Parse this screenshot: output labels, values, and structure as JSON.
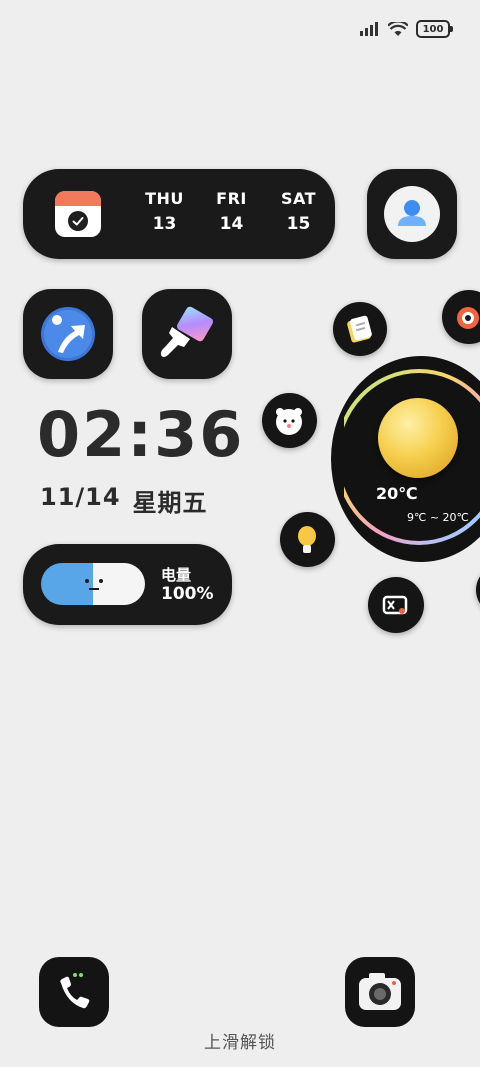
{
  "status_bar": {
    "battery": "100"
  },
  "calendar": {
    "days": [
      {
        "name": "THU",
        "num": "13"
      },
      {
        "name": "FRI",
        "num": "14"
      },
      {
        "name": "SAT",
        "num": "15"
      }
    ]
  },
  "clock": {
    "time": "02:36",
    "date": "11/14",
    "weekday": "星期五"
  },
  "battery_widget": {
    "label": "电量",
    "value": "100%"
  },
  "weather": {
    "temp": "20℃",
    "range": "9℃ ~ 20℃"
  },
  "lock": {
    "hint": "上滑解锁"
  },
  "colors": {
    "background": "#eeeeee",
    "widget_dark": "#1a1a1a",
    "calendar_red": "#f07a5b",
    "pill_blue": "#58a6e8",
    "sun_yellow": "#f6cf4e"
  }
}
